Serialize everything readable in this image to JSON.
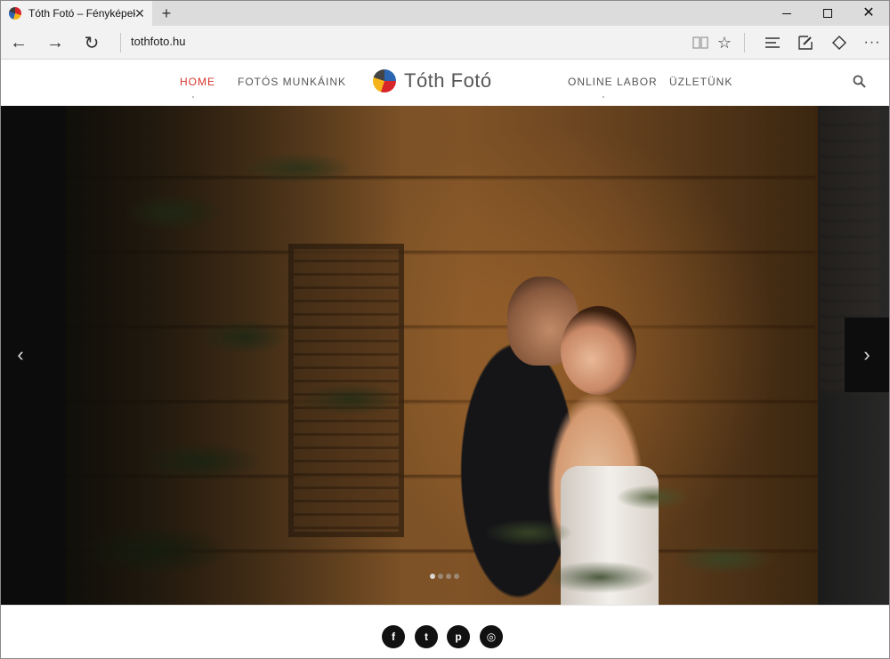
{
  "browser": {
    "tab_title": "Tóth Fotó – Fényképek é",
    "close_glyph": "✕",
    "newtab_glyph": "+",
    "address": "tothfoto.hu",
    "icons": {
      "back": "←",
      "forward": "→",
      "refresh": "↻",
      "favorite": "☆",
      "more": "···"
    }
  },
  "site": {
    "logo_text": "Tóth Fotó",
    "menu": {
      "home": "HOME",
      "works": "FOTÓS MUNKÁINK",
      "lab": "ONLINE LABOR",
      "shop": "ÜZLETÜNK"
    },
    "accent_color": "#d8362d"
  },
  "slider": {
    "prev_glyph": "‹",
    "next_glyph": "›",
    "dots": 4,
    "active_dot": 1
  },
  "social": {
    "facebook": "f",
    "twitter": "t",
    "pinterest": "p",
    "instagram": "◎"
  }
}
